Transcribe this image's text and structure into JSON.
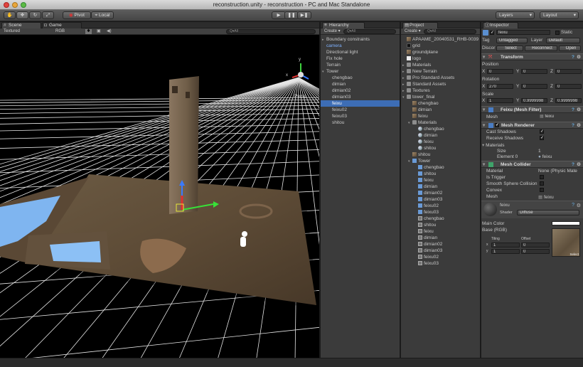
{
  "window": {
    "title": "reconstruction.unity - reconstruction - PC and Mac Standalone"
  },
  "toolbar": {
    "tools": [
      {
        "name": "hand-tool-icon",
        "glyph": "✋"
      },
      {
        "name": "move-tool-icon",
        "glyph": "✥"
      },
      {
        "name": "rotate-tool-icon",
        "glyph": "↻"
      },
      {
        "name": "scale-tool-icon",
        "glyph": "⤢"
      }
    ],
    "pivot_label": "Pivot",
    "local_label": "Local",
    "play_glyph": "▶",
    "pause_glyph": "❚❚",
    "step_glyph": "▶❚",
    "layers_label": "Layers",
    "layout_label": "Layout"
  },
  "scene": {
    "tab_scene": "Scene",
    "tab_game": "Game",
    "shading_mode": "Textured",
    "render_mode": "RGB",
    "persp_label": "Persp",
    "gizmo_axes": {
      "y": "y",
      "x": "x",
      "z": "z"
    }
  },
  "hierarchy": {
    "tab": "Hierarchy",
    "create_label": "Create ▾",
    "search_placeholder": "Q▾All",
    "items": [
      {
        "label": "Boundary constraints",
        "indent": 1,
        "arrow": "▸",
        "highlight": false,
        "selected": false
      },
      {
        "label": "camera",
        "indent": 1,
        "arrow": "",
        "highlight": true,
        "selected": false
      },
      {
        "label": "Directional light",
        "indent": 1,
        "arrow": "",
        "highlight": false,
        "selected": false
      },
      {
        "label": "Fix hole",
        "indent": 1,
        "arrow": "",
        "highlight": false,
        "selected": false
      },
      {
        "label": "Terrain",
        "indent": 1,
        "arrow": "",
        "highlight": false,
        "selected": false
      },
      {
        "label": "Tower",
        "indent": 1,
        "arrow": "▾",
        "highlight": false,
        "selected": false
      },
      {
        "label": "chengbao",
        "indent": 2,
        "arrow": "",
        "highlight": false,
        "selected": false
      },
      {
        "label": "dimian",
        "indent": 2,
        "arrow": "",
        "highlight": false,
        "selected": false
      },
      {
        "label": "dimian02",
        "indent": 2,
        "arrow": "",
        "highlight": false,
        "selected": false
      },
      {
        "label": "dimian03",
        "indent": 2,
        "arrow": "",
        "highlight": false,
        "selected": false
      },
      {
        "label": "feixu",
        "indent": 2,
        "arrow": "",
        "highlight": false,
        "selected": true
      },
      {
        "label": "feixu02",
        "indent": 2,
        "arrow": "",
        "highlight": false,
        "selected": false
      },
      {
        "label": "feixu03",
        "indent": 2,
        "arrow": "",
        "highlight": false,
        "selected": false
      },
      {
        "label": "shitou",
        "indent": 2,
        "arrow": "",
        "highlight": false,
        "selected": false
      }
    ]
  },
  "project": {
    "tab": "Project",
    "create_label": "Create ▾",
    "search_placeholder": "Q▾All",
    "items": [
      {
        "label": "APAAME_20040531_RHB-0039",
        "indent": 1,
        "arrow": "",
        "icon": "image"
      },
      {
        "label": "grid",
        "indent": 1,
        "arrow": "",
        "icon": "dark"
      },
      {
        "label": "groundplane",
        "indent": 1,
        "arrow": "",
        "icon": "image"
      },
      {
        "label": "logo",
        "indent": 1,
        "arrow": "",
        "icon": "white"
      },
      {
        "label": "Materials",
        "indent": 1,
        "arrow": "▸",
        "icon": "folder"
      },
      {
        "label": "New Terrain",
        "indent": 1,
        "arrow": "▸",
        "icon": "folder"
      },
      {
        "label": "Pro Standard Assets",
        "indent": 1,
        "arrow": "▸",
        "icon": "folder"
      },
      {
        "label": "Standard Assets",
        "indent": 1,
        "arrow": "▸",
        "icon": "folder"
      },
      {
        "label": "Textures",
        "indent": 1,
        "arrow": "▸",
        "icon": "folder"
      },
      {
        "label": "tower_final",
        "indent": 1,
        "arrow": "▾",
        "icon": "folder"
      },
      {
        "label": "chengbao",
        "indent": 2,
        "arrow": "",
        "icon": "image"
      },
      {
        "label": "dimian",
        "indent": 2,
        "arrow": "",
        "icon": "image"
      },
      {
        "label": "feixu",
        "indent": 2,
        "arrow": "",
        "icon": "image"
      },
      {
        "label": "Materials",
        "indent": 2,
        "arrow": "▾",
        "icon": "folder"
      },
      {
        "label": "chengbao",
        "indent": 3,
        "arrow": "",
        "icon": "sphere"
      },
      {
        "label": "dimian",
        "indent": 3,
        "arrow": "",
        "icon": "sphere"
      },
      {
        "label": "feixu",
        "indent": 3,
        "arrow": "",
        "icon": "sphere"
      },
      {
        "label": "shitou",
        "indent": 3,
        "arrow": "",
        "icon": "sphere"
      },
      {
        "label": "shitou",
        "indent": 2,
        "arrow": "",
        "icon": "image"
      },
      {
        "label": "Tower",
        "indent": 2,
        "arrow": "▾",
        "icon": "cube"
      },
      {
        "label": "chengbao",
        "indent": 3,
        "arrow": "",
        "icon": "cube"
      },
      {
        "label": "shitou",
        "indent": 3,
        "arrow": "",
        "icon": "cube"
      },
      {
        "label": "feixu",
        "indent": 3,
        "arrow": "",
        "icon": "cube"
      },
      {
        "label": "dimian",
        "indent": 3,
        "arrow": "",
        "icon": "cube"
      },
      {
        "label": "dimian02",
        "indent": 3,
        "arrow": "",
        "icon": "cube"
      },
      {
        "label": "dimian03",
        "indent": 3,
        "arrow": "",
        "icon": "cube"
      },
      {
        "label": "feixu02",
        "indent": 3,
        "arrow": "",
        "icon": "cube"
      },
      {
        "label": "feixu03",
        "indent": 3,
        "arrow": "",
        "icon": "cube"
      },
      {
        "label": "chengbao",
        "indent": 3,
        "arrow": "",
        "icon": "mesh"
      },
      {
        "label": "shitou",
        "indent": 3,
        "arrow": "",
        "icon": "mesh"
      },
      {
        "label": "feixu",
        "indent": 3,
        "arrow": "",
        "icon": "mesh"
      },
      {
        "label": "dimian",
        "indent": 3,
        "arrow": "",
        "icon": "mesh"
      },
      {
        "label": "dimian02",
        "indent": 3,
        "arrow": "",
        "icon": "mesh"
      },
      {
        "label": "dimian03",
        "indent": 3,
        "arrow": "",
        "icon": "mesh"
      },
      {
        "label": "feixu02",
        "indent": 3,
        "arrow": "",
        "icon": "mesh"
      },
      {
        "label": "feixu03",
        "indent": 3,
        "arrow": "",
        "icon": "mesh"
      }
    ]
  },
  "inspector": {
    "tab": "Inspector",
    "object_name": "feixu",
    "static_label": "Static",
    "tag_label": "Tag",
    "tag_value": "Untagged",
    "layer_label": "Layer",
    "layer_value": "Default",
    "prefab_label": "Discor",
    "prefab_select": "Select",
    "prefab_reconnect": "Reconnect",
    "prefab_open": "Open",
    "transform": {
      "title": "Transform",
      "position_label": "Position",
      "position": {
        "x": "0",
        "y": "0",
        "z": "0"
      },
      "rotation_label": "Rotation",
      "rotation": {
        "x": "270",
        "y": "0",
        "z": "0"
      },
      "scale_label": "Scale",
      "scale": {
        "x": "1",
        "y": "0.9999998",
        "z": "0.9999998"
      }
    },
    "mesh_filter": {
      "title": "Feixu (Mesh Filter)",
      "mesh_label": "Mesh",
      "mesh_value": "feixu"
    },
    "mesh_renderer": {
      "title": "Mesh Renderer",
      "cast_shadows_label": "Cast Shadows",
      "cast_shadows": true,
      "receive_shadows_label": "Receive Shadows",
      "receive_shadows": true,
      "materials_label": "Materials",
      "size_label": "Size",
      "size_value": "1",
      "element0_label": "Element 0",
      "element0_value": "feixu"
    },
    "mesh_collider": {
      "title": "Mesh Collider",
      "material_label": "Material",
      "material_value": "None (Physic Mate",
      "is_trigger_label": "Is Trigger",
      "smooth_label": "Smooth Sphere Collision",
      "convex_label": "Convex",
      "mesh_label": "Mesh",
      "mesh_value": "feixu"
    },
    "material": {
      "name": "feixu",
      "shader_label": "Shader",
      "shader_value": "Diffuse",
      "main_color_label": "Main Color",
      "base_label": "Base (RGB)",
      "tiling_label": "Tiling",
      "offset_label": "Offset",
      "tiling_x": "1",
      "tiling_y": "1",
      "offset_x": "0",
      "offset_y": "0",
      "select_label": "Select"
    }
  },
  "colors": {
    "selection": "#3d6db5",
    "panel": "#3b3b3b",
    "highlight_text": "#7fb2ff"
  }
}
